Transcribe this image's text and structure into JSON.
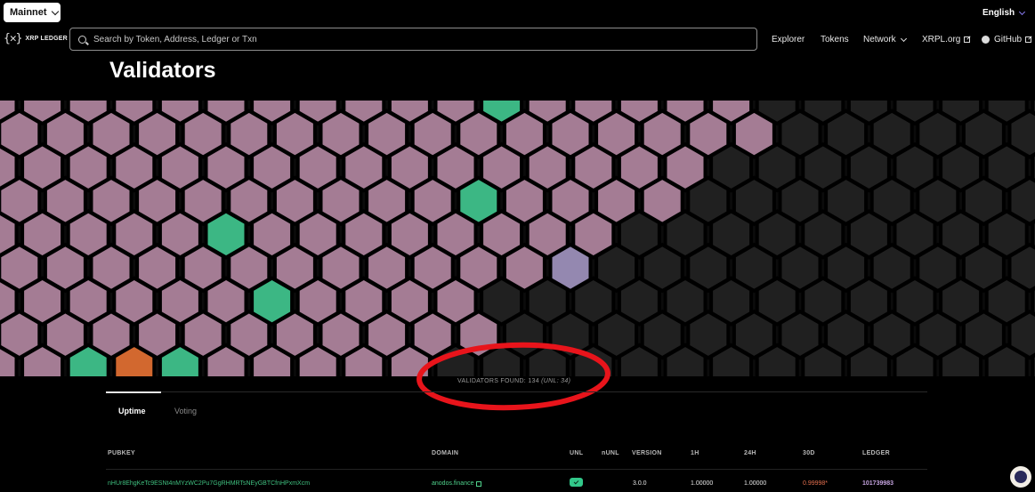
{
  "header": {
    "network_select": "Mainnet",
    "language": "English",
    "logo_text": "XRP LEDGER",
    "logo_mark": "{✕}",
    "search_placeholder": "Search by Token, Address, Ledger or Txn",
    "nav": {
      "explorer": "Explorer",
      "tokens": "Tokens",
      "network": "Network",
      "xrpl_org": "XRPL.org",
      "github": "GitHub"
    }
  },
  "page_title": "Validators",
  "hexmap": {
    "colors": {
      "validator": "#a47c94",
      "active": "#3cb784",
      "selected": "#9488b0",
      "warning": "#d2682f",
      "empty": "#202020",
      "border": "#000000"
    }
  },
  "validators_found": {
    "label": "VALIDATORS FOUND:",
    "count": "134",
    "unl": "(UNL: 34)"
  },
  "annotation": {
    "color": "#e8141b"
  },
  "tabs": [
    {
      "label": "Uptime",
      "active": true
    },
    {
      "label": "Voting",
      "active": false
    }
  ],
  "table": {
    "headers": {
      "pubkey": "PUBKEY",
      "domain": "DOMAIN",
      "unl": "UNL",
      "nunl": "nUNL",
      "version": "VERSION",
      "h1": "1H",
      "h24": "24H",
      "d30": "30D",
      "ledger": "LEDGER"
    },
    "rows": [
      {
        "pubkey": "nHUr8EhgKeTc9ESNt4nMYzWC2Pu7GgRHMRTsNEyGBTCfnHPxmXcm",
        "domain": "anodos.finance",
        "unl": true,
        "version": "3.0.0",
        "h1": "1.00000",
        "h24": "1.00000",
        "d30": "0.99998*",
        "ledger": "101739983"
      }
    ]
  }
}
